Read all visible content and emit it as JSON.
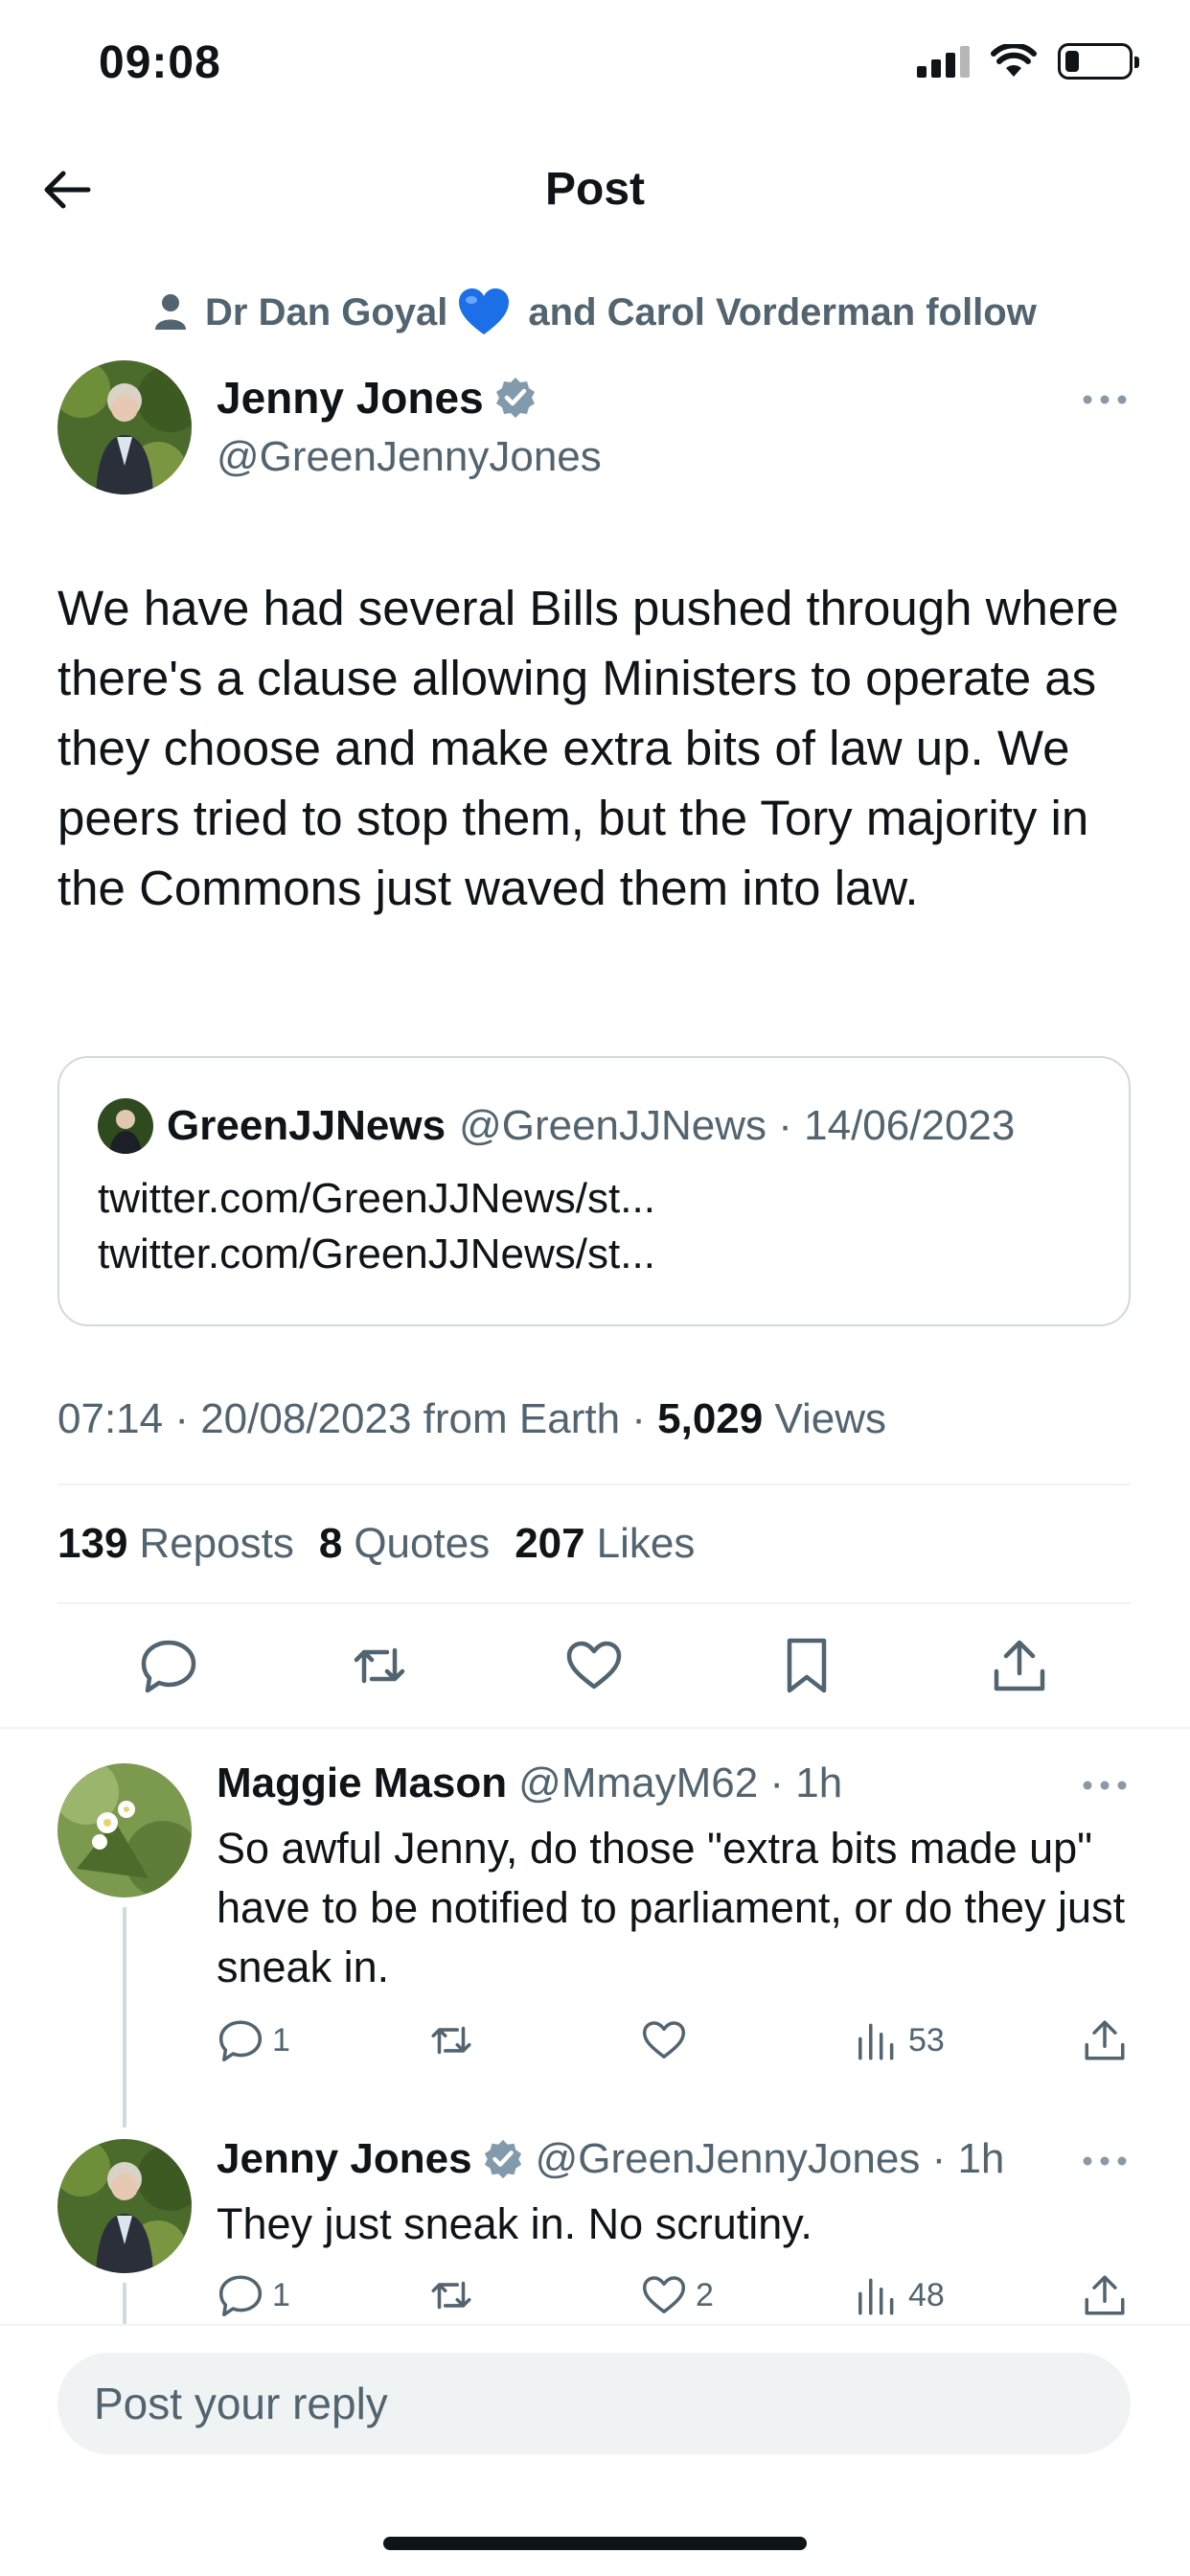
{
  "status_bar": {
    "time": "09:08"
  },
  "nav": {
    "title": "Post"
  },
  "social_context": {
    "name1": "Dr Dan Goyal",
    "rest": "and Carol Vorderman follow"
  },
  "tweet": {
    "author_name": "Jenny Jones",
    "author_handle": "@GreenJennyJones",
    "text": "We have had several Bills pushed through where there's a clause allowing Ministers to operate as they choose and make extra bits of law up. We peers tried to stop them, but the Tory majority in the Commons just waved them into law.",
    "quote": {
      "name": "GreenJJNews",
      "meta": "@GreenJJNews · 14/06/2023",
      "text": "twitter.com/GreenJJNews/st... twitter.com/GreenJJNews/st..."
    },
    "timestamp": "07:14 · 20/08/2023 from Earth · ",
    "views_count": "5,029",
    "views_label": " Views",
    "stats": {
      "reposts_count": "139",
      "reposts_label": "Reposts",
      "quotes_count": "8",
      "quotes_label": "Quotes",
      "likes_count": "207",
      "likes_label": "Likes"
    }
  },
  "replies": [
    {
      "name": "Maggie Mason",
      "meta": "@MmayM62 · 1h",
      "text": "So awful Jenny, do those \"extra bits made up\" have to be notified to parliament, or do they just sneak in.",
      "replies_count": "1",
      "likes_count": "",
      "views_count": "53"
    },
    {
      "name": "Jenny Jones",
      "meta": "@GreenJennyJones · 1h",
      "text": "They just sneak in. No scrutiny.",
      "replies_count": "1",
      "likes_count": "2",
      "views_count": "48"
    }
  ],
  "reply_bar": {
    "placeholder": "Post your reply"
  },
  "colors": {
    "text": "#0f1419",
    "secondary": "#536471",
    "verified": "#829aab",
    "divider": "#eff3f4",
    "heart": "#1d6fe8"
  },
  "icons": [
    "back-arrow-icon",
    "person-icon",
    "blue-heart-emoji",
    "verified-badge-icon",
    "more-icon",
    "reply-icon",
    "repost-icon",
    "like-icon",
    "bookmark-icon",
    "share-icon",
    "views-icon"
  ]
}
